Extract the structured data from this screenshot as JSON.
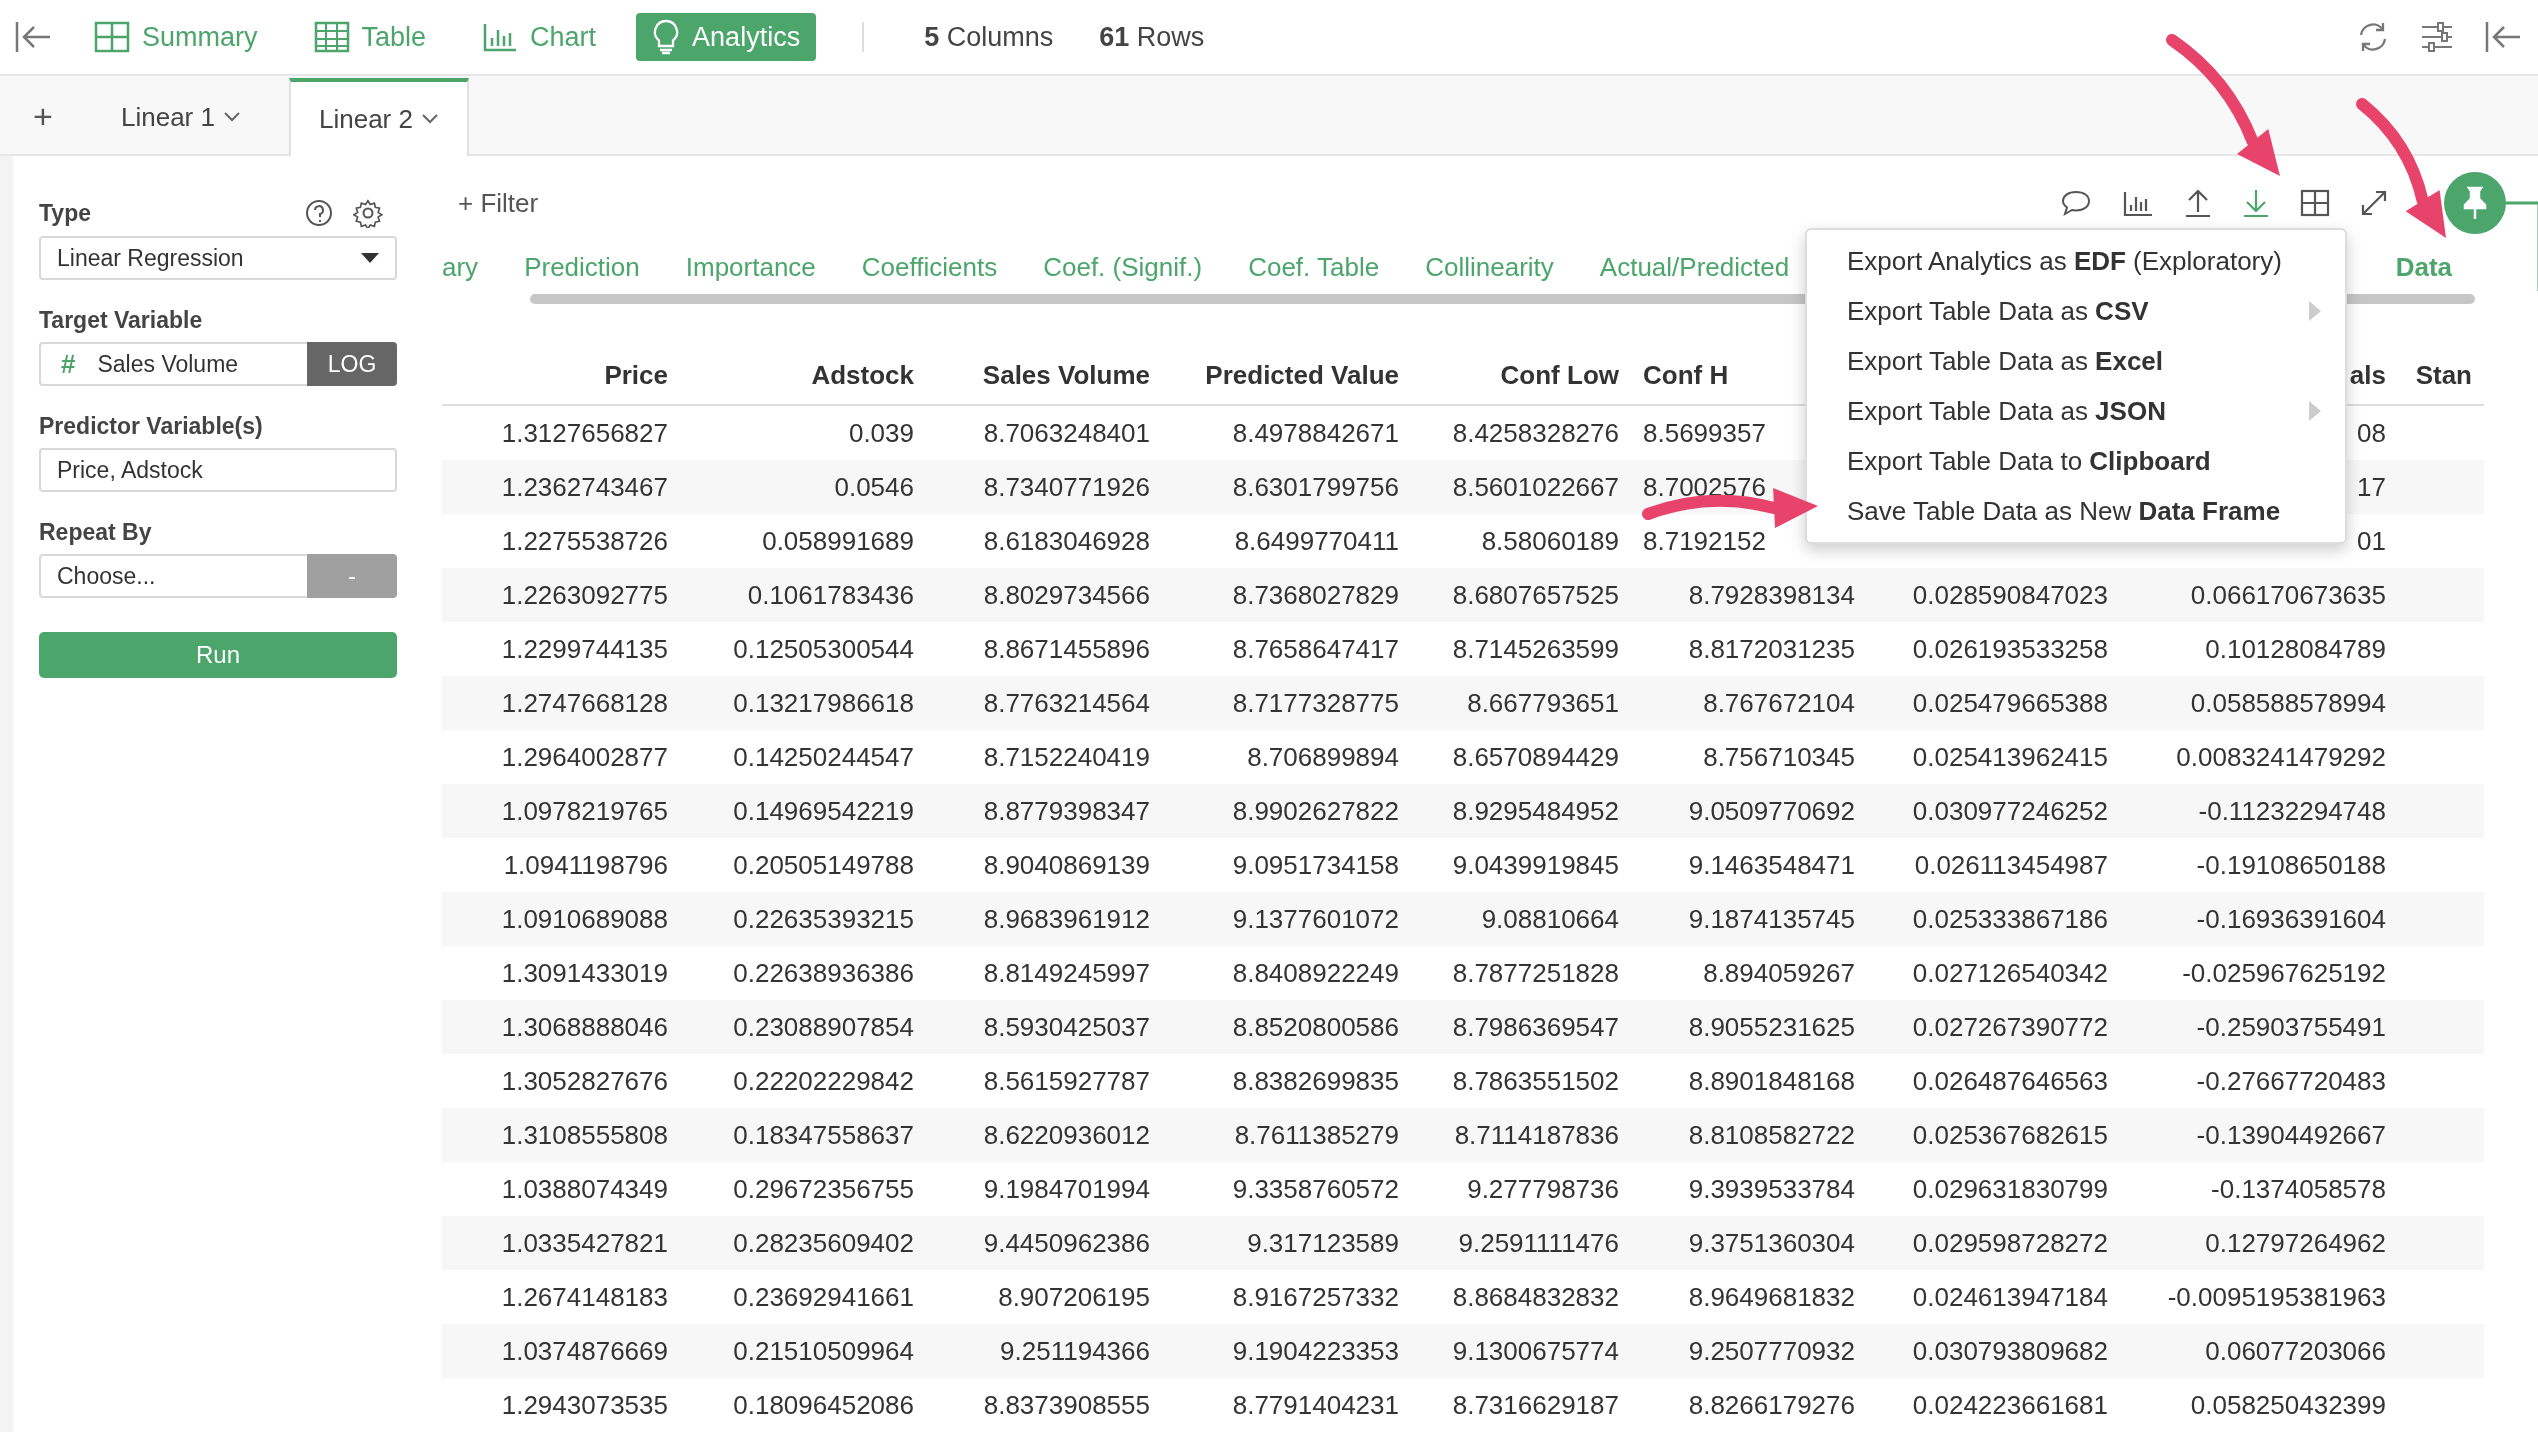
{
  "nav": [
    {
      "kind": "summary",
      "label": "Summary",
      "selected": false
    },
    {
      "kind": "table",
      "label": "Table",
      "selected": false
    },
    {
      "kind": "chart",
      "label": "Chart",
      "selected": false
    },
    {
      "kind": "analytics",
      "label": "Analytics",
      "selected": true
    }
  ],
  "stats": [
    "**5** Columns",
    "**61** Rows"
  ],
  "tabs": {
    "add": "+",
    "items": [
      {
        "label": "Linear 1",
        "selected": false
      },
      {
        "label": "Linear 2",
        "selected": true
      }
    ]
  },
  "sidebar": {
    "type": {
      "label": "Type",
      "value": "Linear Regression"
    },
    "target": {
      "label": "Target Variable",
      "icon": "#",
      "value": "Sales Volume",
      "option": "LOG"
    },
    "predictors": {
      "label": "Predictor Variable(s)",
      "value": "Price, Adstock"
    },
    "repeat_by": {
      "label": "Repeat By",
      "placeholder": "Choose...",
      "option": "-"
    },
    "run": "Run"
  },
  "filter": {
    "icon": "+",
    "label": "Filter"
  },
  "toolbar": [
    {
      "kind": "comment",
      "selected": false
    },
    {
      "kind": "chart",
      "selected": false
    },
    {
      "kind": "upload",
      "selected": false
    },
    {
      "kind": "download",
      "selected": true
    },
    {
      "kind": "grid",
      "selected": false
    },
    {
      "kind": "expand",
      "selected": false
    }
  ],
  "analysis_tabs": [
    {
      "label": "ary",
      "selected": false
    },
    {
      "label": "Prediction",
      "selected": false
    },
    {
      "label": "Importance",
      "selected": false
    },
    {
      "label": "Coefficients",
      "selected": false
    },
    {
      "label": "Coef. (Signif.)",
      "selected": false
    },
    {
      "label": "Coef. Table",
      "selected": false
    },
    {
      "label": "Collinearity",
      "selected": false
    },
    {
      "label": "Actual/Predicted",
      "selected": false
    },
    {
      "label": "Data",
      "selected": true
    }
  ],
  "export_menu": [
    {
      "label": "Export Analytics as **EDF** (Exploratory)",
      "submenu": false
    },
    {
      "label": "Export Table Data as **CSV**",
      "submenu": true
    },
    {
      "label": "Export Table Data as **Excel**",
      "submenu": false
    },
    {
      "label": "Export Table Data as **JSON**",
      "submenu": true
    },
    {
      "label": "Export Table Data to **Clipboard**",
      "submenu": false
    },
    {
      "label": "Save Table Data as New **Data Frame**",
      "submenu": false
    }
  ],
  "table": {
    "columns": [
      "Price",
      "Adstock",
      "Sales Volume",
      "Predicted Value",
      "Conf Low",
      "Conf H",
      null,
      "als",
      "Stan"
    ],
    "rows": [
      [
        "1.3127656827",
        "0.039",
        "8.7063248401",
        "8.4978842671",
        "8.4258328276",
        "8.5699357",
        null,
        "08"
      ],
      [
        "1.2362743467",
        "0.0546",
        "8.7340771926",
        "8.6301799756",
        "8.5601022667",
        "8.7002576",
        null,
        "17"
      ],
      [
        "1.2275538726",
        "0.058991689",
        "8.6183046928",
        "8.6499770411",
        "8.58060189",
        "8.7192152",
        null,
        "01"
      ],
      [
        "1.2263092775",
        "0.1061783436",
        "8.8029734566",
        "8.7368027829",
        "8.6807657525",
        "8.7928398134",
        "0.028590847023",
        "0.066170673635"
      ],
      [
        "1.2299744135",
        "0.12505300544",
        "8.8671455896",
        "8.7658647417",
        "8.7145263599",
        "8.8172031235",
        "0.026193533258",
        "0.10128084789"
      ],
      [
        "1.2747668128",
        "0.13217986618",
        "8.7763214564",
        "8.7177328775",
        "8.667793651",
        "8.767672104",
        "0.025479665388",
        "0.058588578994"
      ],
      [
        "1.2964002877",
        "0.14250244547",
        "8.7152240419",
        "8.706899894",
        "8.6570894429",
        "8.756710345",
        "0.025413962415",
        "0.0083241479292"
      ],
      [
        "1.0978219765",
        "0.14969542219",
        "8.8779398347",
        "8.9902627822",
        "8.9295484952",
        "9.0509770692",
        "0.030977246252",
        "-0.11232294748"
      ],
      [
        "1.0941198796",
        "0.20505149788",
        "8.9040869139",
        "9.0951734158",
        "9.0439919845",
        "9.1463548471",
        "0.026113454987",
        "-0.19108650188"
      ],
      [
        "1.0910689088",
        "0.22635393215",
        "8.9683961912",
        "9.1377601072",
        "9.08810664",
        "9.1874135745",
        "0.025333867186",
        "-0.16936391604"
      ],
      [
        "1.3091433019",
        "0.22638936386",
        "8.8149245997",
        "8.8408922249",
        "8.7877251828",
        "8.894059267",
        "0.027126540342",
        "-0.025967625192"
      ],
      [
        "1.3068888046",
        "0.23088907854",
        "8.5930425037",
        "8.8520800586",
        "8.7986369547",
        "8.9055231625",
        "0.027267390772",
        "-0.25903755491"
      ],
      [
        "1.3052827676",
        "0.22202229842",
        "8.5615927787",
        "8.8382699835",
        "8.7863551502",
        "8.8901848168",
        "0.026487646563",
        "-0.27667720483"
      ],
      [
        "1.3108555808",
        "0.18347558637",
        "8.6220936012",
        "8.7611385279",
        "8.7114187836",
        "8.8108582722",
        "0.025367682615",
        "-0.13904492667"
      ],
      [
        "1.0388074349",
        "0.29672356755",
        "9.1984701994",
        "9.3358760572",
        "9.277798736",
        "9.3939533784",
        "0.029631830799",
        "-0.1374058578"
      ],
      [
        "1.0335427821",
        "0.28235609402",
        "9.4450962386",
        "9.317123589",
        "9.2591111476",
        "9.3751360304",
        "0.029598728272",
        "0.12797264962"
      ],
      [
        "1.2674148183",
        "0.23692941661",
        "8.907206195",
        "8.9167257332",
        "8.8684832832",
        "8.9649681832",
        "0.024613947184",
        "-0.0095195381963"
      ],
      [
        "1.0374876669",
        "0.21510509964",
        "9.251194366",
        "9.1904223353",
        "9.1300675774",
        "9.2507770932",
        "0.030793809682",
        "0.06077203066"
      ],
      [
        "1.2943073535",
        "0.18096452086",
        "8.8373908555",
        "8.7791404231",
        "8.7316629187",
        "8.8266179276",
        "0.024223661681",
        "0.058250432399"
      ]
    ]
  }
}
